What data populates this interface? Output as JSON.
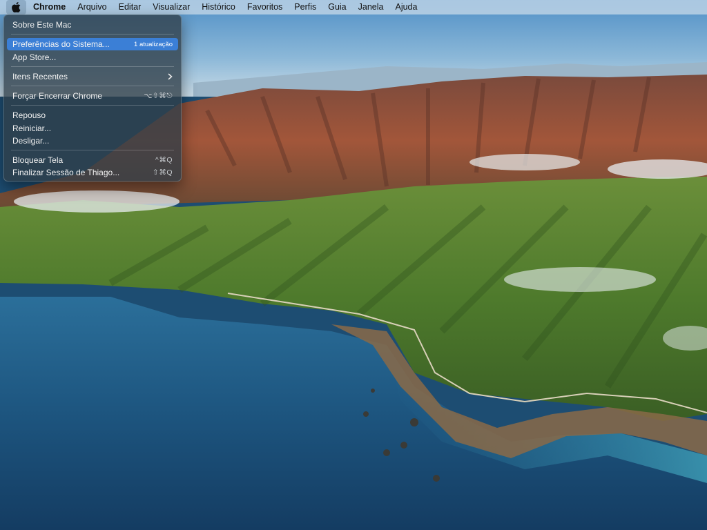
{
  "menubar": {
    "apple_icon": "apple-logo-icon",
    "app_name": "Chrome",
    "items": [
      "Arquivo",
      "Editar",
      "Visualizar",
      "Histórico",
      "Favoritos",
      "Perfis",
      "Guia",
      "Janela",
      "Ajuda"
    ]
  },
  "apple_menu": {
    "about": "Sobre Este Mac",
    "system_prefs": "Preferências do Sistema...",
    "system_prefs_badge": "1 atualização",
    "app_store": "App Store...",
    "recent_items": "Itens Recentes",
    "recent_items_icon": "chevron-right-icon",
    "force_quit": "Forçar Encerrar Chrome",
    "force_quit_shortcut": "⌥⇧⌘⎋",
    "sleep": "Repouso",
    "restart": "Reiniciar...",
    "shutdown": "Desligar...",
    "lock_screen": "Bloquear Tela",
    "lock_screen_shortcut": "^⌘Q",
    "logout": "Finalizar Sessão de Thiago...",
    "logout_shortcut": "⇧⌘Q",
    "highlight_color": "#3b7fd6"
  }
}
